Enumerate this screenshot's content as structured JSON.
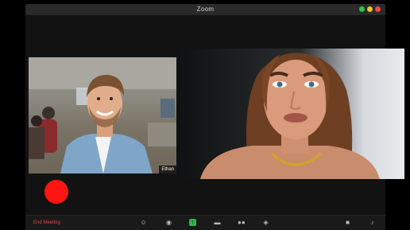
{
  "window": {
    "title": "Zoom",
    "traffic_colors": [
      "#2fc23f",
      "#f2c12e",
      "#f24b45"
    ]
  },
  "participants": [
    {
      "name": "Ethan",
      "name_label": "Ethan",
      "video": "man-in-office"
    },
    {
      "name": "",
      "name_label": "",
      "video": "woman-portrait"
    }
  ],
  "toolbar": {
    "end_meeting_label": "End Meeting",
    "icons": [
      "reactions-icon",
      "record-icon",
      "share-screen-icon",
      "chat-icon",
      "participants-icon",
      "security-icon",
      "video-icon",
      "microphone-icon"
    ]
  },
  "colors": {
    "record": "#ff1414",
    "end_meeting": "#e04a4a",
    "share": "#2fb24c"
  }
}
